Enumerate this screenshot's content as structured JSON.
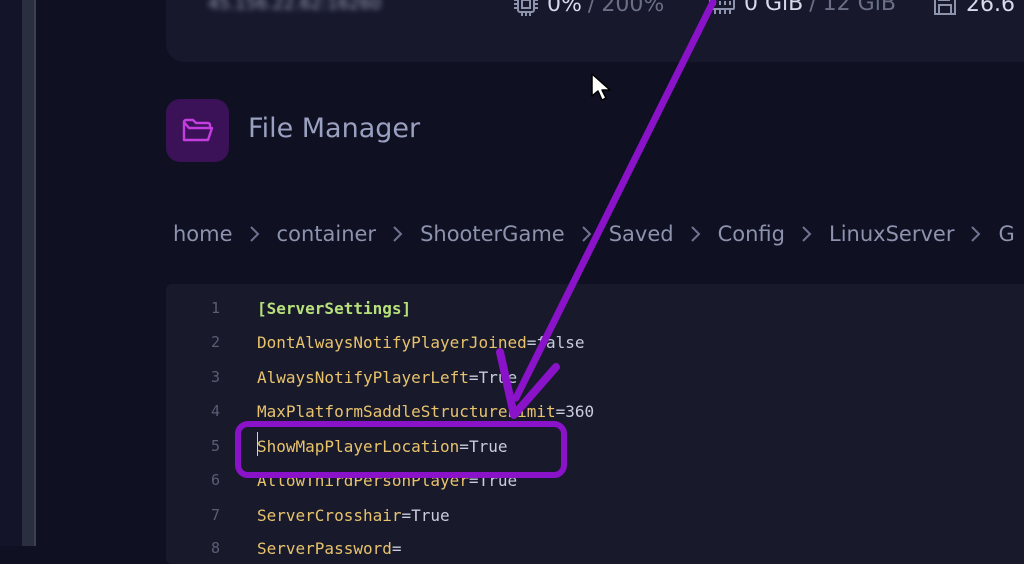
{
  "stats": {
    "address_blurred": "45.156.22.62:16260",
    "cpu": {
      "value": "0%",
      "limit": "200%",
      "icon": "cpu-icon"
    },
    "memory": {
      "value": "0 GiB",
      "limit": "12 GiB",
      "icon": "memory-icon"
    },
    "disk": {
      "value": "26.6",
      "icon": "disk-icon"
    }
  },
  "header": {
    "title": "File Manager",
    "icon": "folder-open-icon"
  },
  "breadcrumb": [
    "home",
    "container",
    "ShooterGame",
    "Saved",
    "Config",
    "LinuxServer",
    "G"
  ],
  "editor": {
    "lines": [
      {
        "n": "1",
        "section": "[ServerSettings]"
      },
      {
        "n": "2",
        "key": "DontAlwaysNotifyPlayerJoined",
        "eq": "=",
        "value": "false"
      },
      {
        "n": "3",
        "key": "AlwaysNotifyPlayerLeft",
        "eq": "=",
        "value": "True"
      },
      {
        "n": "4",
        "key": "MaxPlatformSaddleStructureLimit",
        "eq": "=",
        "value": "360"
      },
      {
        "n": "5",
        "key": "ShowMapPlayerLocation",
        "eq": "=",
        "value": "True"
      },
      {
        "n": "6",
        "key": "AllowThirdPersonPlayer",
        "eq": "=",
        "value": "True"
      },
      {
        "n": "7",
        "key": "ServerCrosshair",
        "eq": "=",
        "value": "True"
      },
      {
        "n": "8",
        "key": "ServerPassword",
        "eq": "=",
        "value": ""
      }
    ]
  },
  "colors": {
    "background": "#0f1022",
    "card": "#17182c",
    "editor": "#181a2c",
    "key": "#e8c36c",
    "section": "#b7e07a",
    "annotation": "#8a12c9"
  }
}
